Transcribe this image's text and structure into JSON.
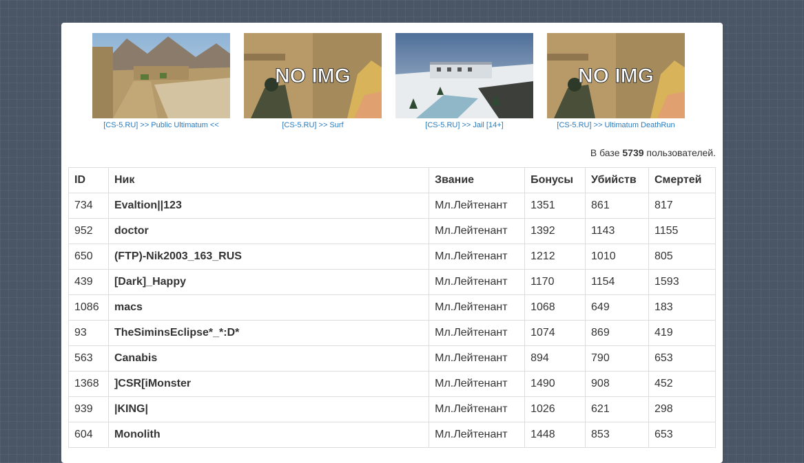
{
  "servers": [
    {
      "label": "[CS-5.RU] >> Public Ultimatum <<",
      "image": "dust2-map-screenshot"
    },
    {
      "label": "[CS-5.RU] >> Surf",
      "image": "no-img-placeholder",
      "overlay": "NO IMG"
    },
    {
      "label": "[CS-5.RU] >> Jail [14+]",
      "image": "snow-jail-map-screenshot"
    },
    {
      "label": "[CS-5.RU] >> Ultimatum DeathRun",
      "image": "no-img-placeholder",
      "overlay": "NO IMG"
    }
  ],
  "stats": {
    "prefix": "В базе ",
    "count": "5739",
    "suffix": " пользователей."
  },
  "table": {
    "headers": [
      "ID",
      "Ник",
      "Звание",
      "Бонусы",
      "Убийств",
      "Смертей"
    ],
    "rows": [
      [
        "734",
        "Evaltion||123",
        "Мл.Лейтенант",
        "1351",
        "861",
        "817"
      ],
      [
        "952",
        "doctor",
        "Мл.Лейтенант",
        "1392",
        "1143",
        "1155"
      ],
      [
        "650",
        "(FTP)-Nik2003_163_RUS",
        "Мл.Лейтенант",
        "1212",
        "1010",
        "805"
      ],
      [
        "439",
        "[Dark]_Happy",
        "Мл.Лейтенант",
        "1170",
        "1154",
        "1593"
      ],
      [
        "1086",
        "macs",
        "Мл.Лейтенант",
        "1068",
        "649",
        "183"
      ],
      [
        "93",
        "TheSiminsEclipse*_*:D*",
        "Мл.Лейтенант",
        "1074",
        "869",
        "419"
      ],
      [
        "563",
        "Canabis",
        "Мл.Лейтенант",
        "894",
        "790",
        "653"
      ],
      [
        "1368",
        "]CSR[iMonster",
        "Мл.Лейтенант",
        "1490",
        "908",
        "452"
      ],
      [
        "939",
        "|KING|",
        "Мл.Лейтенант",
        "1026",
        "621",
        "298"
      ],
      [
        "604",
        "Monolith",
        "Мл.Лейтенант",
        "1448",
        "853",
        "653"
      ]
    ]
  }
}
